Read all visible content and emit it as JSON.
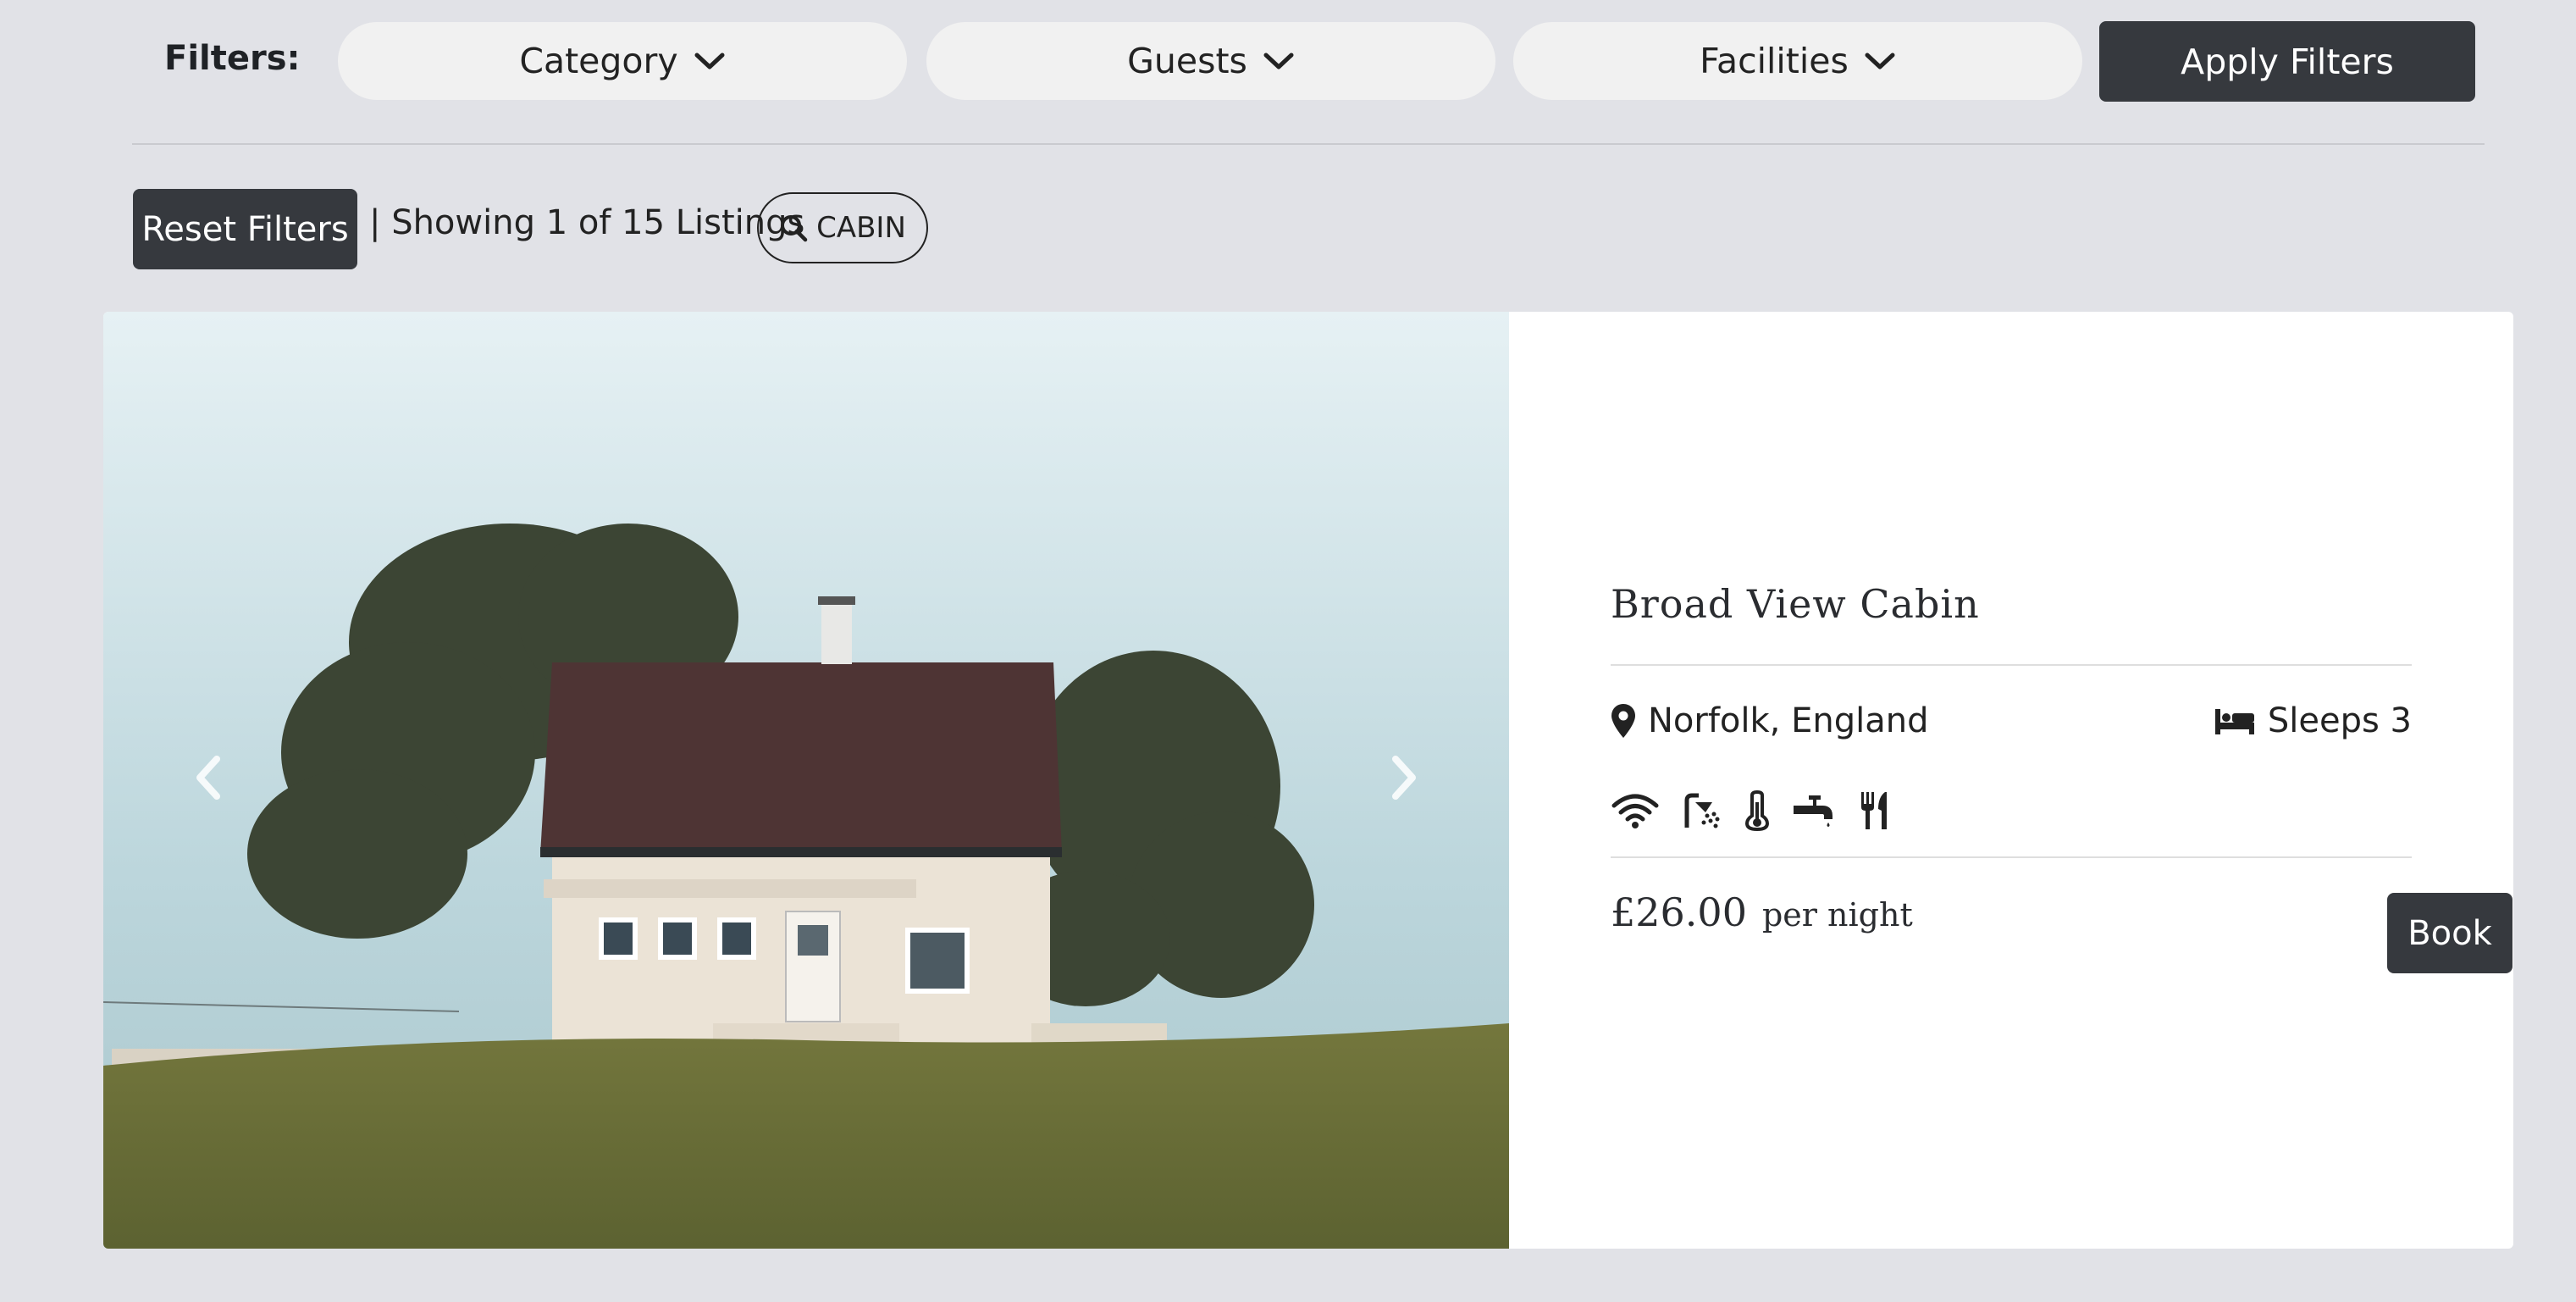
{
  "filters": {
    "label": "Filters:",
    "dropdowns": [
      {
        "label": "Category",
        "icon": "chevron-down-icon"
      },
      {
        "label": "Guests",
        "icon": "chevron-down-icon"
      },
      {
        "label": "Facilities",
        "icon": "chevron-down-icon"
      }
    ],
    "apply_label": "Apply Filters"
  },
  "results": {
    "reset_label": "Reset Filters",
    "showing_text": "| Showing 1 of 15 Listings",
    "search_tag": "CABIN",
    "search_icon": "search-icon"
  },
  "listing": {
    "title": "Broad View Cabin",
    "location": "Norfolk, England",
    "sleeps": "Sleeps 3",
    "amenities": [
      "wifi-icon",
      "shower-icon",
      "thermometer-icon",
      "faucet-icon",
      "utensils-icon"
    ],
    "price": "£26.00",
    "per_night": "per night",
    "book_label": "Book"
  },
  "colors": {
    "page_bg": "#e1e2e7",
    "button_dark": "#36393e",
    "pill_bg": "#f1f1f1"
  }
}
